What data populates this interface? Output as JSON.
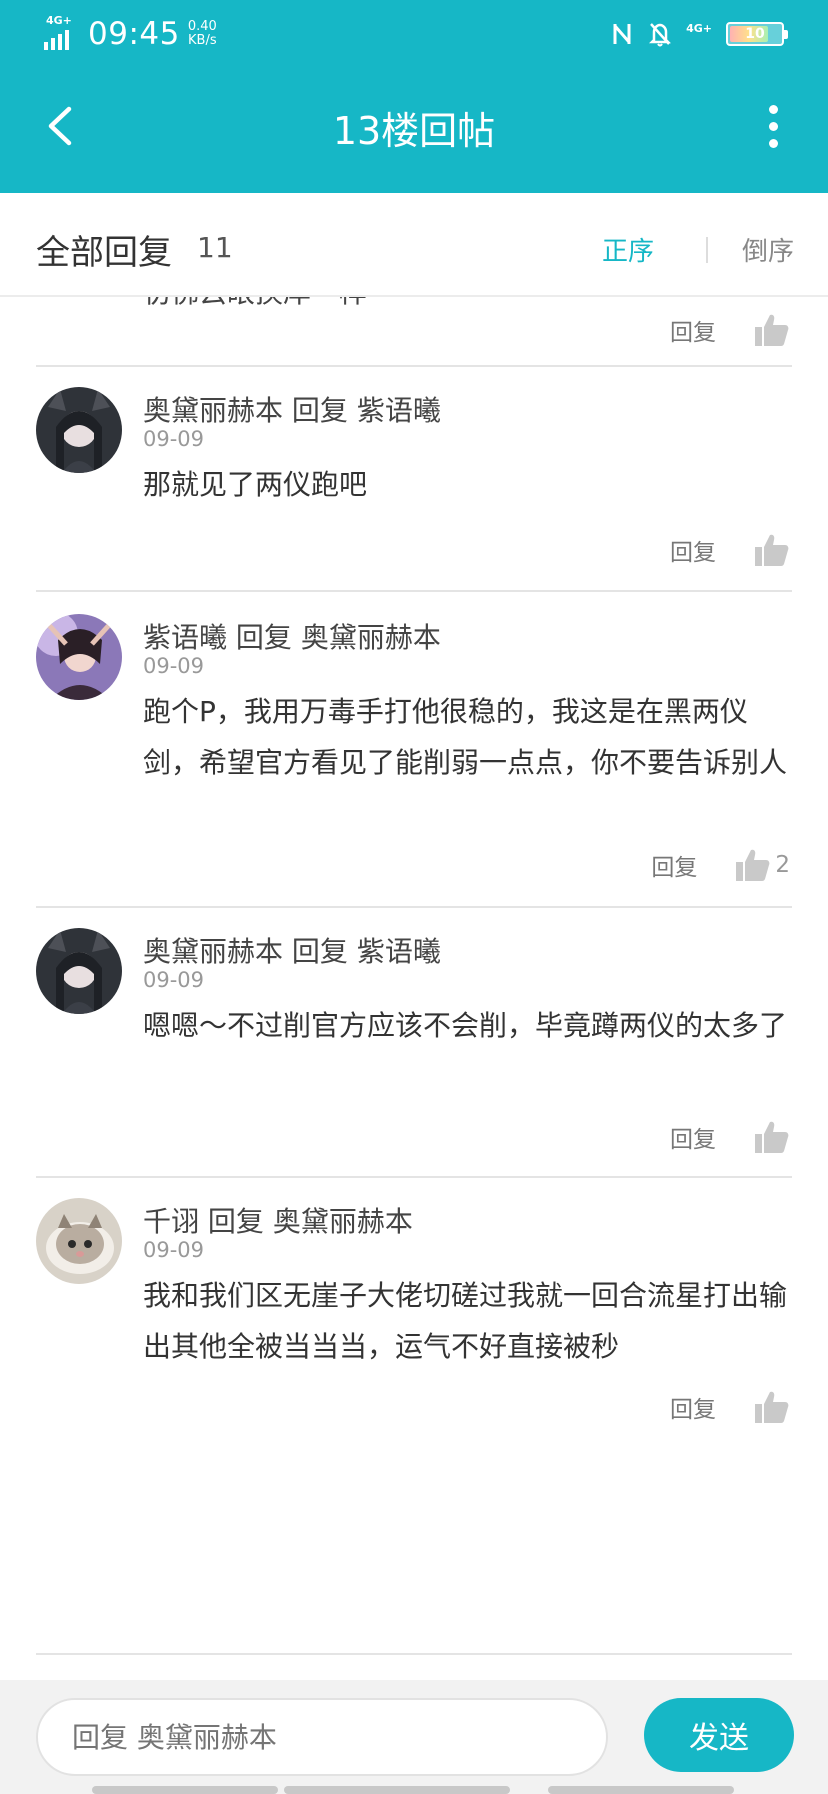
{
  "status_bar": {
    "network_label": "4G+",
    "time": "09:45",
    "speed_value": "0.40",
    "speed_unit": "KB/s",
    "right_network_label": "4G+",
    "battery_text": "10"
  },
  "appbar": {
    "title": "13楼回帖",
    "back_icon": "back-arrow-icon",
    "more_icon": "more-vertical-icon"
  },
  "header": {
    "title": "全部回复",
    "count": "11",
    "sort_asc": "正序",
    "sort_desc": "倒序"
  },
  "partial_item": {
    "content": "彷佛云眼换岸一样",
    "reply_label": "回复"
  },
  "replies": [
    {
      "user": "奥黛丽赫本",
      "action": "回复",
      "target": "紫语曦",
      "date": "09-09",
      "content": "那就见了两仪跑吧",
      "reply_label": "回复",
      "likes": ""
    },
    {
      "user": "紫语曦",
      "action": "回复",
      "target": "奥黛丽赫本",
      "date": "09-09",
      "content": "跑个P，我用万毒手打他很稳的，我这是在黑两仪剑，希望官方看见了能削弱一点点，你不要告诉别人",
      "reply_label": "回复",
      "likes": "2"
    },
    {
      "user": "奥黛丽赫本",
      "action": "回复",
      "target": "紫语曦",
      "date": "09-09",
      "content": "嗯嗯～不过削官方应该不会削，毕竟蹲两仪的太多了",
      "reply_label": "回复",
      "likes": ""
    },
    {
      "user": "千诩",
      "action": "回复",
      "target": "奥黛丽赫本",
      "date": "09-09",
      "content": "我和我们区无崖子大佬切磋过我就一回合流星打出输出其他全被当当当，运气不好直接被秒",
      "reply_label": "回复",
      "likes": ""
    }
  ],
  "bottom": {
    "input_placeholder": "回复 奥黛丽赫本",
    "send_label": "发送"
  },
  "colors": {
    "accent": "#16b7c6",
    "divider": "#e4e4e4"
  }
}
